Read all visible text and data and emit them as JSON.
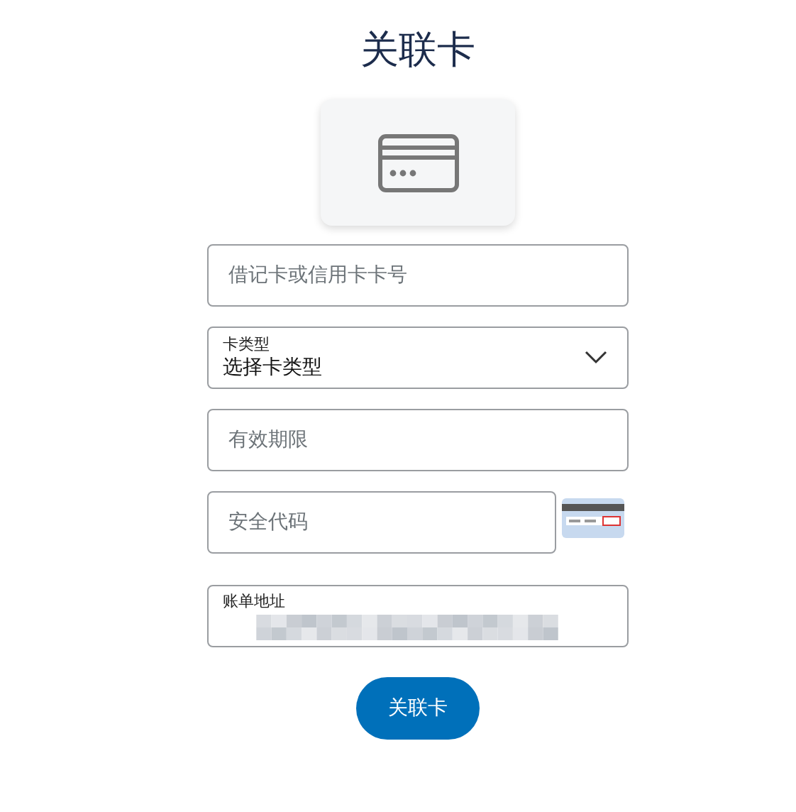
{
  "title": "关联卡",
  "fields": [
    {
      "kind": "text",
      "placeholder": "借记卡或信用卡卡号"
    },
    {
      "kind": "select",
      "label": "卡类型",
      "value": "选择卡类型"
    },
    {
      "kind": "text",
      "placeholder": "有效期限"
    },
    {
      "kind": "cvv",
      "placeholder": "安全代码"
    },
    {
      "kind": "redacted",
      "label": "账单地址"
    }
  ],
  "button": "关联卡"
}
